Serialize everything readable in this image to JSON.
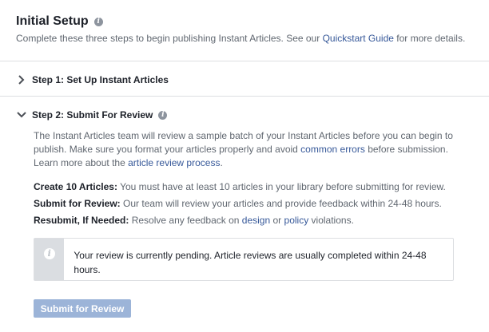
{
  "header": {
    "title": "Initial Setup",
    "subtitle_before": "Complete these three steps to begin publishing Instant Articles. See our ",
    "subtitle_link": "Quickstart Guide",
    "subtitle_after": " for more details."
  },
  "steps": [
    {
      "label": "Step 1: Set Up Instant Articles",
      "expanded": false
    },
    {
      "label": "Step 2: Submit For Review",
      "expanded": true
    }
  ],
  "review": {
    "intro_1": "The Instant Articles team will review a sample batch of your Instant Articles before you can begin to publish. Make sure you format your articles properly and avoid ",
    "intro_link_1": "common errors",
    "intro_2": " before submission. Learn more about the ",
    "intro_link_2": "article review process",
    "intro_3": ".",
    "requirements": [
      {
        "label": "Create 10 Articles:",
        "text": "You must have at least 10 articles in your library before submitting for review."
      },
      {
        "label": "Submit for Review:",
        "text": "Our team will review your articles and provide feedback within 24-48 hours."
      },
      {
        "label": "Resubmit, If Needed:",
        "text": "Resolve any feedback on ",
        "link_a": "design",
        "mid": " or ",
        "link_b": "policy",
        "tail": " violations."
      }
    ],
    "notice": "Your review is currently pending. Article reviews are usually completed within 24-48 hours.",
    "submit_label": "Submit for Review"
  },
  "colors": {
    "link": "#365899",
    "button_disabled": "#9cb4d8"
  },
  "icons": {
    "info": "info-icon",
    "chevron_right": "chevron-right-icon",
    "chevron_down": "chevron-down-icon"
  }
}
